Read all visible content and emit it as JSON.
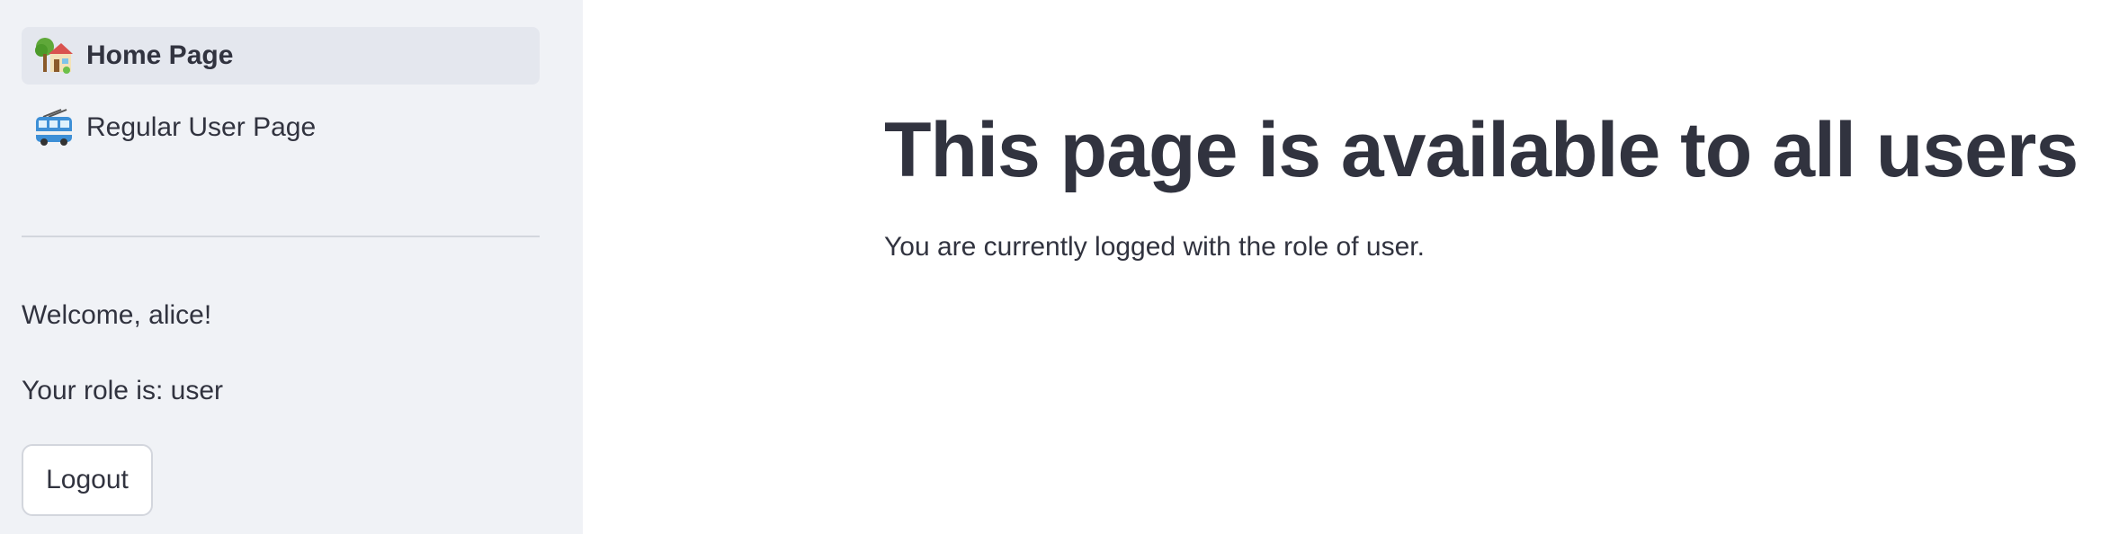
{
  "sidebar": {
    "nav": [
      {
        "label": "Home Page",
        "icon": "house-with-garden-icon",
        "active": true
      },
      {
        "label": "Regular User Page",
        "icon": "trolleybus-icon",
        "active": false
      }
    ],
    "welcome_text": "Welcome, alice!",
    "role_text": "Your role is: user",
    "logout_label": "Logout"
  },
  "main": {
    "title": "This page is available to all users",
    "body_text": "You are currently logged with the role of user."
  },
  "colors": {
    "sidebar_bg": "#f0f2f6",
    "active_item_bg": "#e4e7ee",
    "text": "#31333f",
    "border": "#d3d6dd"
  }
}
